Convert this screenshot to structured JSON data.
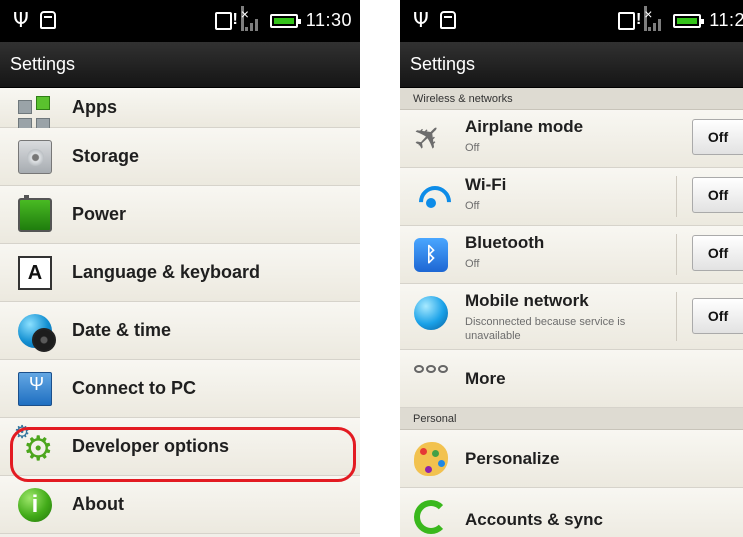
{
  "left_screen": {
    "status": {
      "time": "11:30"
    },
    "title": "Settings",
    "items": [
      {
        "label": "Apps",
        "icon": "apps-icon"
      },
      {
        "label": "Storage",
        "icon": "storage-icon"
      },
      {
        "label": "Power",
        "icon": "battery-icon"
      },
      {
        "label": "Language & keyboard",
        "icon": "keyboard-icon"
      },
      {
        "label": "Date & time",
        "icon": "globe-clock-icon"
      },
      {
        "label": "Connect to PC",
        "icon": "usb-pc-icon"
      },
      {
        "label": "Developer options",
        "icon": "gears-icon"
      },
      {
        "label": "About",
        "icon": "info-icon"
      }
    ],
    "highlighted_item": "Developer options",
    "highlight_color": "#e31b22"
  },
  "right_screen": {
    "status": {
      "time": "11:2"
    },
    "title": "Settings",
    "sections": [
      {
        "header": "Wireless & networks",
        "items": [
          {
            "title": "Airplane mode",
            "subtitle": "Off",
            "toggle": "Off",
            "icon": "airplane-icon"
          },
          {
            "title": "Wi-Fi",
            "subtitle": "Off",
            "toggle": "Off",
            "icon": "wifi-icon"
          },
          {
            "title": "Bluetooth",
            "subtitle": "Off",
            "toggle": "Off",
            "icon": "bluetooth-icon"
          },
          {
            "title": "Mobile network",
            "subtitle": "Disconnected because service is unavailable",
            "toggle": "Off",
            "icon": "globe-icon"
          },
          {
            "title": "More",
            "icon": "more-icon"
          }
        ]
      },
      {
        "header": "Personal",
        "items": [
          {
            "title": "Personalize",
            "icon": "palette-icon"
          },
          {
            "title": "Accounts & sync",
            "icon": "sync-icon"
          }
        ]
      }
    ]
  },
  "colors": {
    "status_bar": "#000000",
    "title_bar": "#1f1f1f",
    "list_background": "#f1efe9",
    "toggle_text": "#111111"
  }
}
